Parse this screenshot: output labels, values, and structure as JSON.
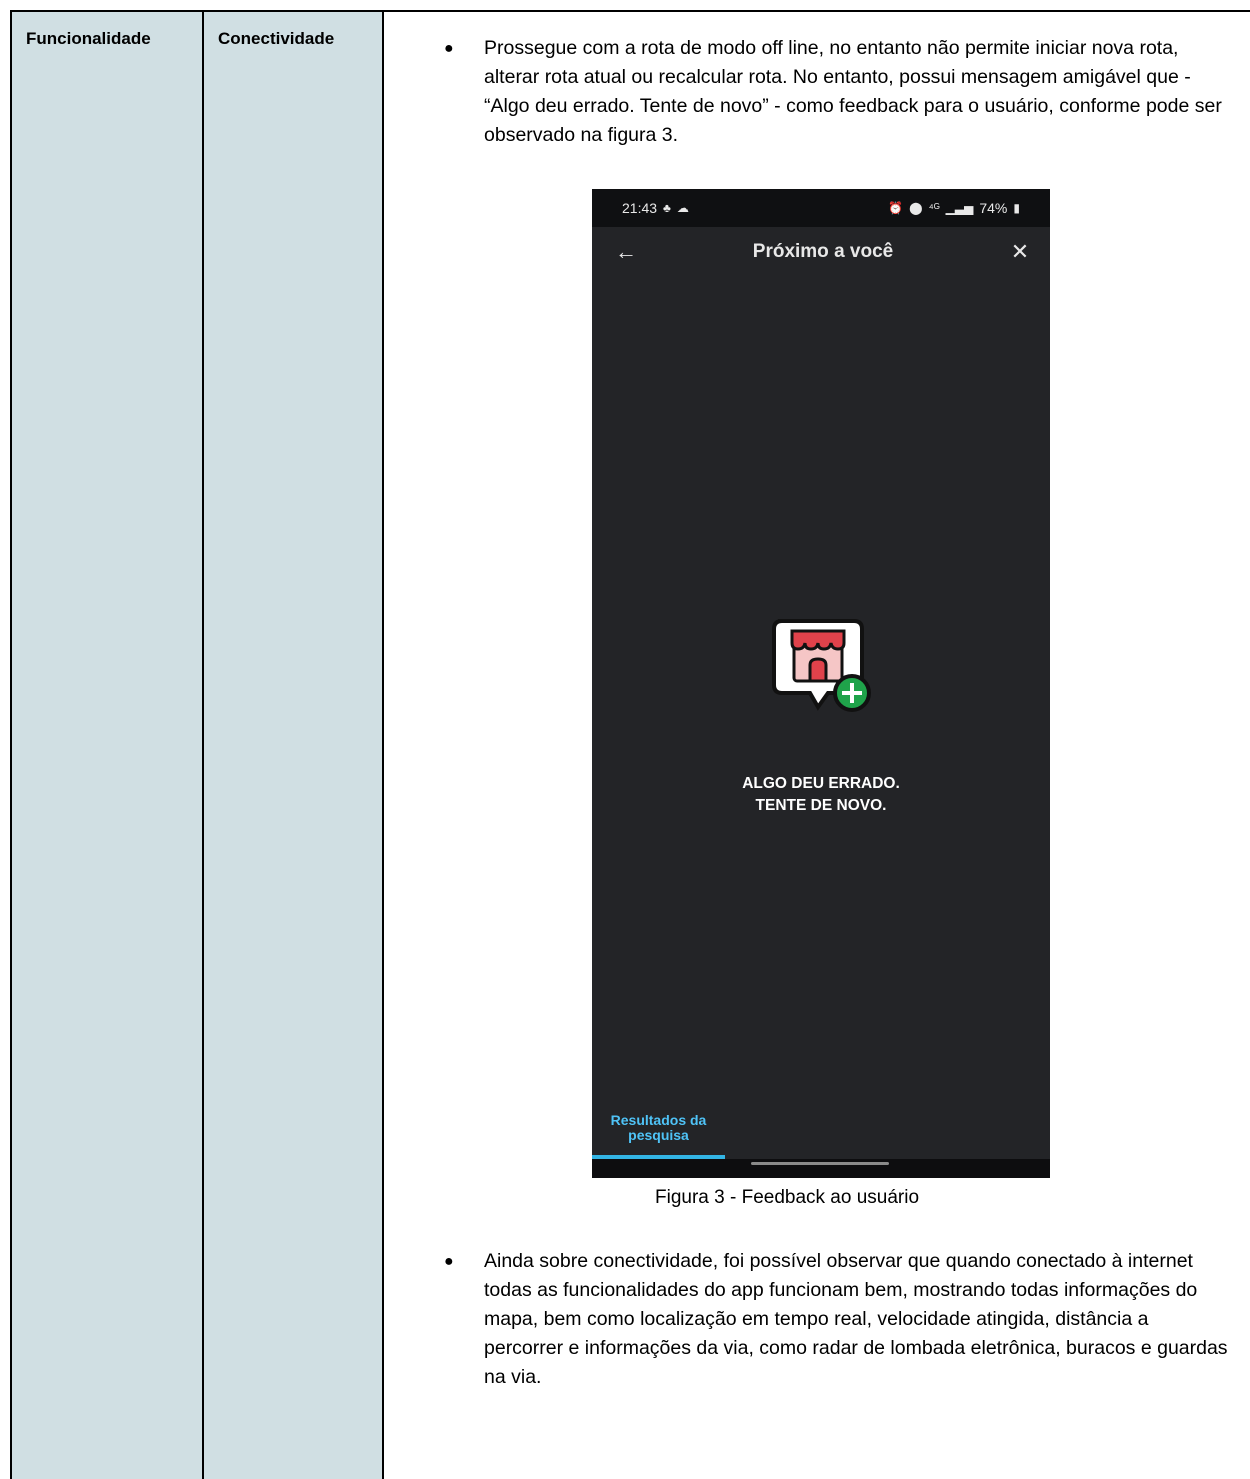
{
  "table": {
    "col1": "Funcionalidade",
    "col2": "Conectividade",
    "bullets": [
      {
        "marker": "●",
        "text": "Prossegue com a rota de modo off line, no entanto não permite iniciar nova rota, alterar rota atual ou recalcular rota. No entanto, possui mensagem amigável que - “Algo deu errado. Tente de novo” - como feedback para o usuário, conforme pode ser observado na figura 3."
      },
      {
        "marker": "●",
        "text": "Ainda sobre conectividade, foi possível observar que quando conectado à internet todas as funcionalidades do app funcionam bem,  mostrando todas informações do mapa, bem como localização em tempo real, velocidade atingida, distância a percorrer e informações da via, como radar de lombada eletrônica, buracos e guardas na via."
      }
    ]
  },
  "figure": {
    "status_bar": {
      "time": "21:43",
      "battery": "74%",
      "icons_left": [
        "person-icon",
        "cloud-icon"
      ],
      "icons_right": [
        "alarm-icon",
        "location-icon",
        "4g-icon",
        "signal-icon",
        "battery-icon"
      ]
    },
    "app_bar": {
      "title": "Próximo a você",
      "back": "←",
      "close": "✕"
    },
    "error_line1": "ALGO DEU ERRADO.",
    "error_line2": "TENTE DE NOVO.",
    "tab_line1": "Resultados da",
    "tab_line2": "pesquisa",
    "caption": "Figura 3 - Feedback ao usuário",
    "colors": {
      "screen_bg": "#232427",
      "accent": "#33b5e5",
      "plus_green": "#1fa34a",
      "awning_red": "#e0424b"
    }
  }
}
